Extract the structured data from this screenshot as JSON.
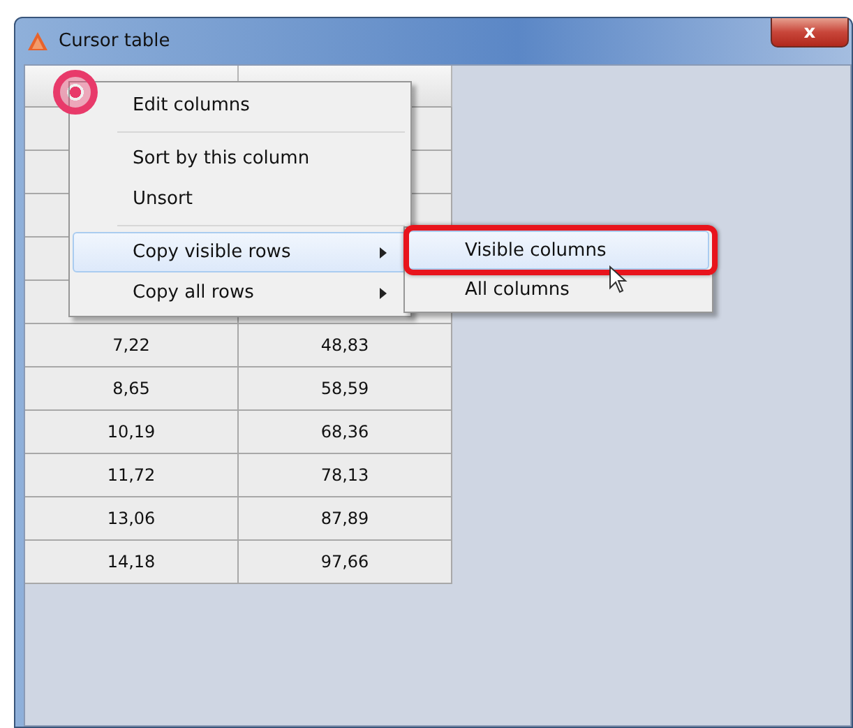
{
  "window": {
    "title": "Cursor table",
    "close_label": "x"
  },
  "table": {
    "rows": [
      {
        "col_1": "7,22",
        "col_2": "48,83"
      },
      {
        "col_1": "8,65",
        "col_2": "58,59"
      },
      {
        "col_1": "10,19",
        "col_2": "68,36"
      },
      {
        "col_1": "11,72",
        "col_2": "78,13"
      },
      {
        "col_1": "13,06",
        "col_2": "87,89"
      },
      {
        "col_1": "14,18",
        "col_2": "97,66"
      }
    ]
  },
  "context_menu": {
    "items": [
      {
        "kind": "item",
        "label": "Edit columns",
        "selected": false,
        "has_submenu": false
      },
      {
        "kind": "separator"
      },
      {
        "kind": "item",
        "label": "Sort by this column",
        "selected": false,
        "has_submenu": false
      },
      {
        "kind": "item",
        "label": "Unsort",
        "selected": false,
        "has_submenu": false
      },
      {
        "kind": "separator"
      },
      {
        "kind": "item",
        "label": "Copy visible rows",
        "selected": true,
        "has_submenu": true
      },
      {
        "kind": "item",
        "label": "Copy all rows",
        "selected": false,
        "has_submenu": true
      }
    ]
  },
  "submenu": {
    "items": [
      {
        "label": "Visible columns",
        "selected": true,
        "annotated": true
      },
      {
        "label": "All columns",
        "selected": false,
        "annotated": false
      }
    ]
  }
}
